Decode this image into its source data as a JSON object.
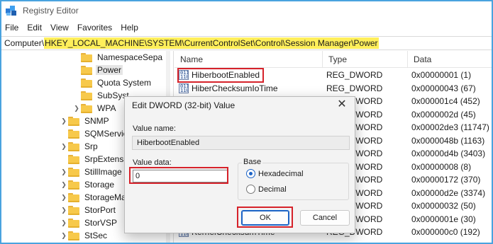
{
  "window": {
    "title": "Registry Editor"
  },
  "menu": [
    "File",
    "Edit",
    "View",
    "Favorites",
    "Help"
  ],
  "address": {
    "prefix": "Computer\\",
    "path": "HKEY_LOCAL_MACHINE\\SYSTEM\\CurrentControlSet\\Control\\Session Manager\\Power"
  },
  "tree": [
    {
      "label": "NamespaceSepa",
      "indent": 1,
      "expander": false,
      "selected": false
    },
    {
      "label": "Power",
      "indent": 1,
      "expander": false,
      "selected": true
    },
    {
      "label": "Quota System",
      "indent": 1,
      "expander": false,
      "selected": false
    },
    {
      "label": "SubSyst",
      "indent": 1,
      "expander": false,
      "selected": false
    },
    {
      "label": "WPA",
      "indent": 1,
      "expander": true,
      "selected": false
    },
    {
      "label": "SNMP",
      "indent": 0,
      "expander": true,
      "selected": false
    },
    {
      "label": "SQMServic",
      "indent": 0,
      "expander": false,
      "selected": false
    },
    {
      "label": "Srp",
      "indent": 0,
      "expander": true,
      "selected": false
    },
    {
      "label": "SrpExtensi",
      "indent": 0,
      "expander": false,
      "selected": false
    },
    {
      "label": "StillImage",
      "indent": 0,
      "expander": true,
      "selected": false
    },
    {
      "label": "Storage",
      "indent": 0,
      "expander": true,
      "selected": false
    },
    {
      "label": "StorageMa",
      "indent": 0,
      "expander": true,
      "selected": false
    },
    {
      "label": "StorPort",
      "indent": 0,
      "expander": true,
      "selected": false
    },
    {
      "label": "StorVSP",
      "indent": 0,
      "expander": true,
      "selected": false
    },
    {
      "label": "StSec",
      "indent": 0,
      "expander": true,
      "selected": false
    }
  ],
  "values_pane": {
    "headers": {
      "name": "Name",
      "type": "Type",
      "data": "Data"
    },
    "rows": [
      {
        "name": "HiberbootEnabled",
        "type": "REG_DWORD",
        "data": "0x00000001 (1)"
      },
      {
        "name": "HiberChecksumIoTime",
        "type": "REG_DWORD",
        "data": "0x00000043 (67)"
      },
      {
        "name": "",
        "type": "REG_DWORD",
        "data": "0x000001c4 (452)"
      },
      {
        "name": "",
        "type": "REG_DWORD",
        "data": "0x0000002d (45)"
      },
      {
        "name": "",
        "type": "REG_DWORD",
        "data": "0x00002de3 (11747)"
      },
      {
        "name": "",
        "type": "REG_DWORD",
        "data": "0x0000048b (1163)"
      },
      {
        "name": "",
        "type": "REG_DWORD",
        "data": "0x00000d4b (3403)"
      },
      {
        "name": "",
        "type": "REG_DWORD",
        "data": "0x00000008 (8)"
      },
      {
        "name": "",
        "type": "REG_DWORD",
        "data": "0x00000172 (370)"
      },
      {
        "name": "",
        "type": "REG_DWORD",
        "data": "0x00000d2e (3374)"
      },
      {
        "name": "",
        "type": "REG_DWORD",
        "data": "0x00000032 (50)"
      },
      {
        "name": "",
        "type": "REG_DWORD",
        "data": "0x0000001e (30)"
      },
      {
        "name": "KernelChecksumTime",
        "type": "REG_DWORD",
        "data": "0x000000c0 (192)"
      }
    ]
  },
  "dialog": {
    "title": "Edit DWORD (32-bit) Value",
    "close_glyph": "✕",
    "value_name_label": "Value name:",
    "value_name": "HiberbootEnabled",
    "value_data_label": "Value data:",
    "value_data": "0",
    "base_label": "Base",
    "base_options": [
      {
        "label": "Hexadecimal",
        "checked": true
      },
      {
        "label": "Decimal",
        "checked": false
      }
    ],
    "ok_label": "OK",
    "cancel_label": "Cancel"
  }
}
